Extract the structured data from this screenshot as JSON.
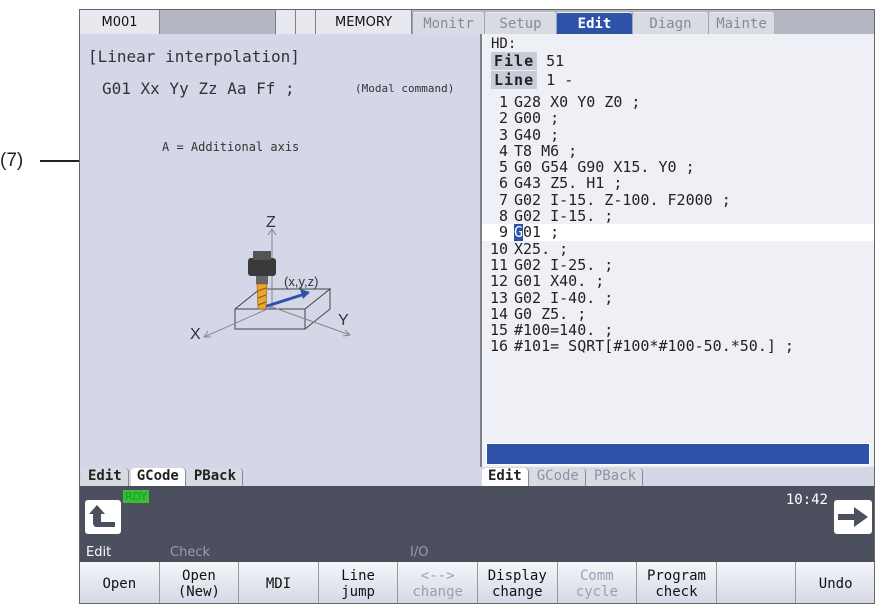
{
  "annotation": "(7)",
  "top_bar": {
    "program": "M001",
    "mode": "MEMORY",
    "tabs": [
      "Monitr",
      "Setup",
      "Edit",
      "Diagn",
      "Mainte"
    ],
    "active_tab": "Edit"
  },
  "left_panel": {
    "heading": "[Linear interpolation]",
    "syntax": "G01 Xx Yy Zz Aa Ff ;",
    "note": "(Modal command)",
    "axis_note": "A = Additional axis",
    "diagram": {
      "label_z": "Z",
      "label_x": "X",
      "label_y": "Y",
      "label_point": "(x,y,z)"
    },
    "tabs": [
      "Edit",
      "GCode",
      "PBack"
    ],
    "active_tab": "GCode"
  },
  "editor": {
    "hd": "HD:",
    "file_label": "File",
    "file_value": "51",
    "line_label": "Line",
    "line_value": "1 -",
    "lines": [
      {
        "n": "1",
        "text": "G28 X0 Y0 Z0 ;"
      },
      {
        "n": "2",
        "text": "G00 ;"
      },
      {
        "n": "3",
        "text": "G40 ;"
      },
      {
        "n": "4",
        "text": "T8 M6 ;"
      },
      {
        "n": "5",
        "text": "G0 G54 G90 X15. Y0 ;"
      },
      {
        "n": "6",
        "text": "G43 Z5. H1 ;"
      },
      {
        "n": "7",
        "text": "G02 I-15. Z-100. F2000 ;"
      },
      {
        "n": "8",
        "text": "G02 I-15. ;"
      },
      {
        "n": "9",
        "cursor": "G",
        "text": "01 ;"
      },
      {
        "n": "10",
        "text": "X25. ;"
      },
      {
        "n": "11",
        "text": "G02 I-25. ;"
      },
      {
        "n": "12",
        "text": "G01 X40. ;"
      },
      {
        "n": "13",
        "text": "G02 I-40. ;"
      },
      {
        "n": "14",
        "text": "G0 Z5. ;"
      },
      {
        "n": "15",
        "text": "#100=140. ;"
      },
      {
        "n": "16",
        "text": "#101= SQRT[#100*#100-50.*50.] ;"
      }
    ],
    "current_line": 9,
    "tabs": [
      "Edit",
      "GCode",
      "PBack"
    ],
    "active_tab": "Edit"
  },
  "status": {
    "ready": "RDY",
    "time": "10:42"
  },
  "menu_mode": {
    "edit": "Edit",
    "check": "Check",
    "io": "I/O"
  },
  "softkeys": [
    {
      "l1": "Open",
      "l2": "",
      "enabled": true
    },
    {
      "l1": "Open",
      "l2": "(New)",
      "enabled": true
    },
    {
      "l1": "MDI",
      "l2": "",
      "enabled": true
    },
    {
      "l1": "Line",
      "l2": "jump",
      "enabled": true
    },
    {
      "l1": "<-->",
      "l2": "change",
      "enabled": false
    },
    {
      "l1": "Display",
      "l2": "change",
      "enabled": true
    },
    {
      "l1": "Comm",
      "l2": "cycle",
      "enabled": false
    },
    {
      "l1": "Program",
      "l2": "check",
      "enabled": true
    },
    {
      "l1": "",
      "l2": "",
      "enabled": true
    },
    {
      "l1": "Undo",
      "l2": "",
      "enabled": true
    }
  ],
  "colors": {
    "accent": "#2d52a8",
    "ready": "#3dbb3a",
    "screen_bg": "#d3d7e8",
    "editor_bg": "#eef0f6"
  }
}
